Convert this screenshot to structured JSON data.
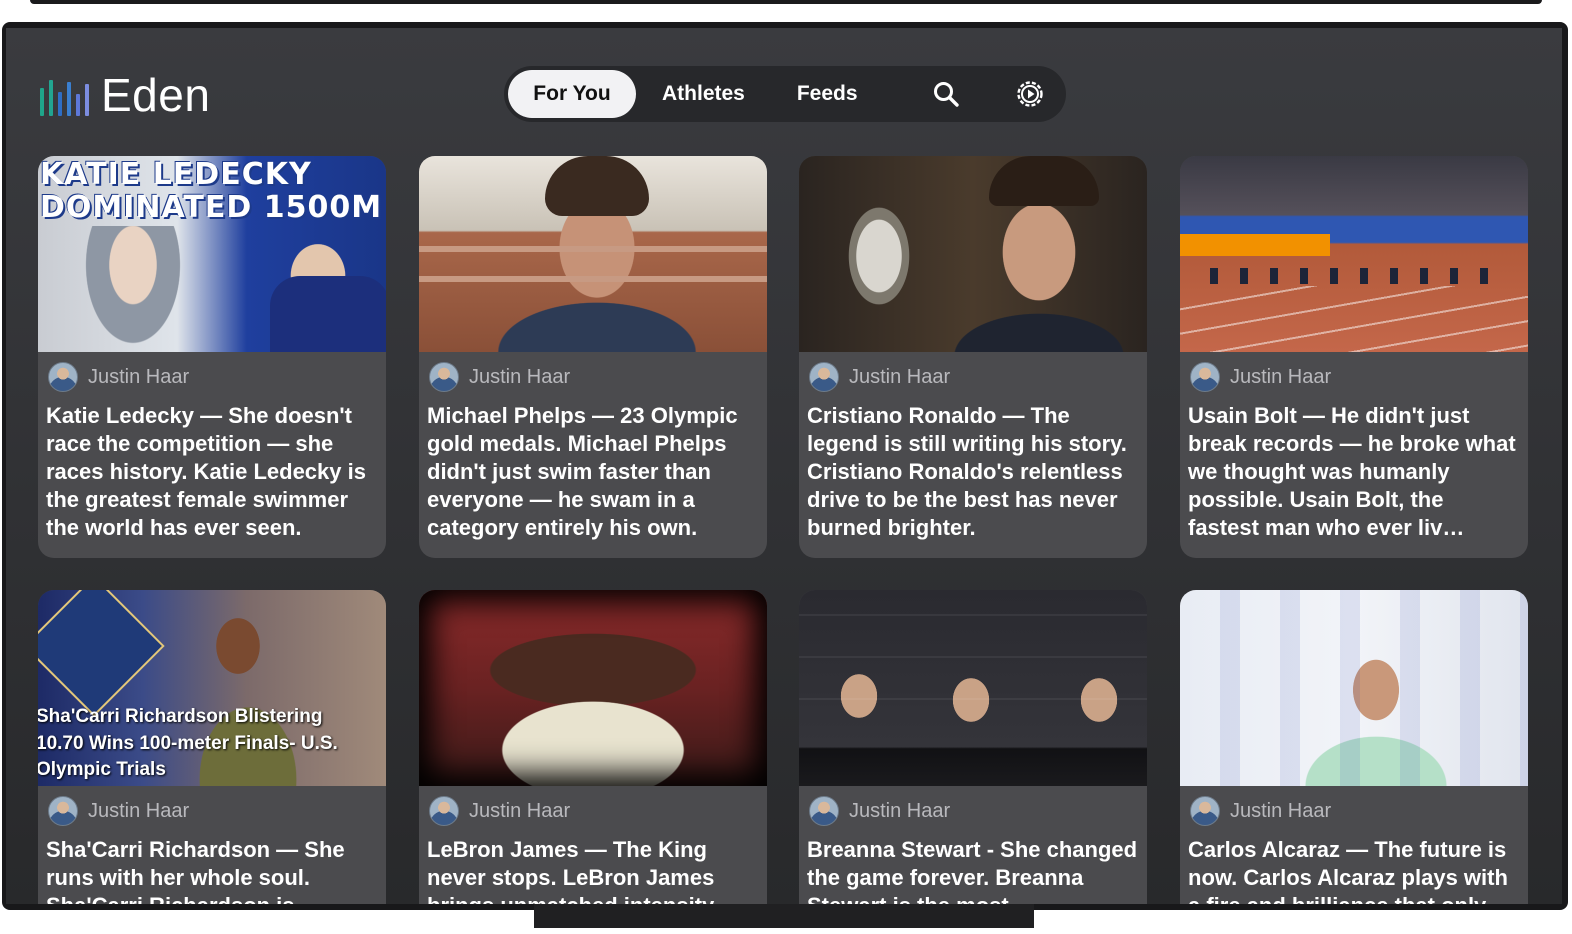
{
  "app": {
    "name": "Eden",
    "accent_colors": [
      "#1fa58a",
      "#2e6ec6",
      "#7c8de0"
    ]
  },
  "nav": {
    "tabs": [
      {
        "label": "For You",
        "active": true
      },
      {
        "label": "Athletes",
        "active": false
      },
      {
        "label": "Feeds",
        "active": false
      }
    ],
    "search_icon": "search-icon",
    "settings_icon": "gear-icon"
  },
  "cards": [
    {
      "author": "Justin Haar",
      "title": "Katie Ledecky — She doesn't race the competition — she races history. Katie Ledecky is the greatest female swimmer the world has ever seen.",
      "thumb_caption": "KATIE LEDECKY DOMINATED 1500M"
    },
    {
      "author": "Justin Haar",
      "title": "Michael Phelps — 23 Olympic gold medals. Michael Phelps didn't just swim faster than everyone — he swam in a category entirely his own."
    },
    {
      "author": "Justin Haar",
      "title": "Cristiano Ronaldo — The legend is still writing his story. Cristiano Ronaldo's relentless drive to be the best has never burned brighter."
    },
    {
      "author": "Justin Haar",
      "title": "Usain Bolt — He didn't just break records — he broke what we thought was humanly possible. Usain Bolt, the fastest man who ever liv…"
    },
    {
      "author": "Justin Haar",
      "title": "Sha'Carri Richardson — She runs with her whole soul. Sha'Carri Richardson is",
      "thumb_caption": "Sha'Carri Richardson Blistering 10.70 Wins 100-meter Finals- U.S. Olympic Trials"
    },
    {
      "author": "Justin Haar",
      "title": "LeBron James — The King never stops. LeBron James brings unmatched intensity"
    },
    {
      "author": "Justin Haar",
      "title": "Breanna Stewart - She changed the game forever. Breanna Stewart is the most"
    },
    {
      "author": "Justin Haar",
      "title": "Carlos Alcaraz — The future is now. Carlos Alcaraz plays with a fire and brilliance that only"
    }
  ]
}
